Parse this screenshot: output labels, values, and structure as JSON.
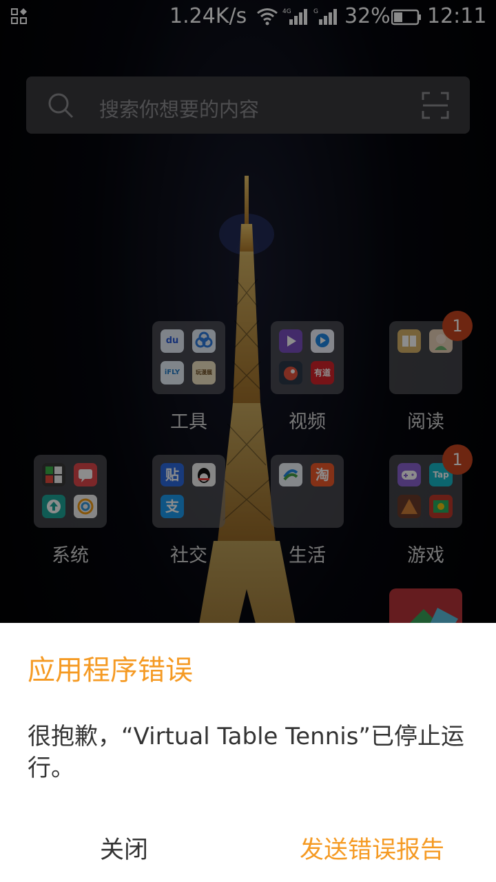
{
  "status_bar": {
    "network_speed": "1.24K/s",
    "sim1_label": "4G",
    "sim2_label": "G",
    "battery_percent": "32%",
    "time": "12:11"
  },
  "search": {
    "placeholder": "搜索你想要的内容"
  },
  "folders": [
    {
      "label": "工具",
      "badge": null,
      "apps": [
        {
          "icon": "baidu-icon",
          "text": "du"
        },
        {
          "icon": "baidu-cloud-icon",
          "text": ""
        },
        {
          "icon": "iflytek-icon",
          "text": "iFLY"
        },
        {
          "icon": "manga-app-icon",
          "text": "玩漫展"
        }
      ]
    },
    {
      "label": "视频",
      "badge": null,
      "apps": [
        {
          "icon": "video-player-icon",
          "text": ""
        },
        {
          "icon": "video-app-icon",
          "text": ""
        },
        {
          "icon": "bird-app-icon",
          "text": ""
        },
        {
          "icon": "youdao-icon",
          "text": "有道"
        }
      ]
    },
    {
      "label": "阅读",
      "badge": "1",
      "apps": [
        {
          "icon": "book-icon",
          "text": ""
        },
        {
          "icon": "anime-reader-icon",
          "text": ""
        }
      ]
    },
    {
      "label": "系统",
      "badge": null,
      "apps": [
        {
          "icon": "system-grid-icon",
          "text": ""
        },
        {
          "icon": "message-icon",
          "text": ""
        },
        {
          "icon": "update-icon",
          "text": ""
        },
        {
          "icon": "theme-icon",
          "text": ""
        }
      ]
    },
    {
      "label": "社交",
      "badge": null,
      "apps": [
        {
          "icon": "tieba-icon",
          "text": "贴"
        },
        {
          "icon": "qq-icon",
          "text": ""
        },
        {
          "icon": "alipay-icon",
          "text": "支"
        }
      ]
    },
    {
      "label": "生活",
      "badge": null,
      "apps": [
        {
          "icon": "china-mobile-icon",
          "text": ""
        },
        {
          "icon": "taobao-icon",
          "text": "淘"
        }
      ]
    },
    {
      "label": "游戏",
      "badge": "1",
      "apps": [
        {
          "icon": "gamepad-icon",
          "text": ""
        },
        {
          "icon": "taptap-icon",
          "text": "Tap"
        },
        {
          "icon": "game-app-icon",
          "text": ""
        },
        {
          "icon": "game-app-2-icon",
          "text": ""
        }
      ]
    }
  ],
  "dialog": {
    "title": "应用程序错误",
    "message": "很抱歉，“Virtual Table Tennis”已停止运行。",
    "close_label": "关闭",
    "report_label": "发送错误报告"
  },
  "colors": {
    "accent": "#f59a23",
    "badge": "#c8451f"
  }
}
